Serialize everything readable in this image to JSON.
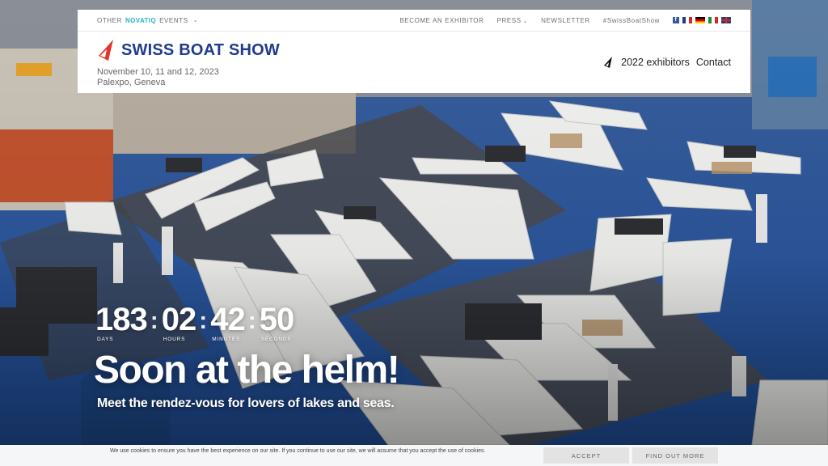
{
  "topbar": {
    "events_prefix": "OTHER",
    "events_brand": "NOVATIQ",
    "events_suffix": "EVENTS",
    "links": [
      "BECOME AN EXHIBITOR",
      "PRESS",
      "NEWSLETTER",
      "#SwissBoatShow"
    ]
  },
  "brand": {
    "name": "SWISS BOAT SHOW",
    "dates": "November 10, 11 and 12, 2023",
    "venue": "Palexpo, Geneva",
    "logo_color": "#e3342f",
    "text_color": "#1f3b8f"
  },
  "nav": {
    "exhibitors": "2022 exhibitors",
    "contact": "Contact"
  },
  "countdown": {
    "days": "183",
    "hours": "02",
    "minutes": "42",
    "seconds": "50",
    "days_label": "DAYS",
    "hours_label": "HOURS",
    "minutes_label": "MINUTES",
    "seconds_label": "SECONDS"
  },
  "hero": {
    "headline": "Soon at the helm!",
    "subline": "Meet the rendez-vous for lovers of lakes and seas."
  },
  "cookie": {
    "text": "We use cookies to ensure you have the best experience on our site. If you continue to use our site, we will assume that you accept the use of cookies.",
    "accept": "ACCEPT",
    "more": "FIND OUT MORE"
  }
}
